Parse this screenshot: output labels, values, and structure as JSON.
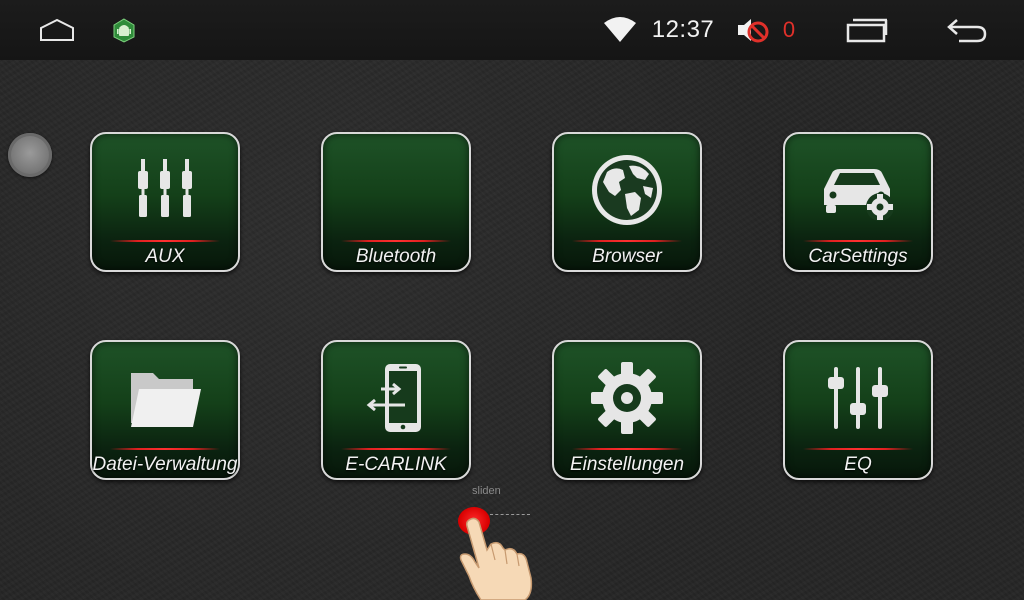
{
  "statusbar": {
    "home_icon": "home-outline-icon",
    "android_icon": "android-debug-icon",
    "wifi_icon": "wifi-icon",
    "time": "12:37",
    "mute_icon": "volume-muted-icon",
    "mute_count": "0",
    "recents_icon": "recent-apps-icon",
    "back_icon": "back-arrow-icon"
  },
  "apps": [
    {
      "label": "AUX",
      "icon": "aux-plugs-icon"
    },
    {
      "label": "Bluetooth",
      "icon": ""
    },
    {
      "label": "Browser",
      "icon": "globe-icon"
    },
    {
      "label": "CarSettings",
      "icon": "car-settings-icon"
    },
    {
      "label": "Datei-Verwaltung",
      "icon": "folder-icon"
    },
    {
      "label": "E-CARLINK",
      "icon": "phone-link-icon"
    },
    {
      "label": "Einstellungen",
      "icon": "gear-icon"
    },
    {
      "label": "EQ",
      "icon": "equalizer-icon"
    }
  ],
  "slide_hint": {
    "text": "sliden",
    "icon": "pointing-hand-icon"
  },
  "colors": {
    "tile_green": "#144019",
    "accent_red": "#e02020",
    "status_red": "#e0302a"
  }
}
